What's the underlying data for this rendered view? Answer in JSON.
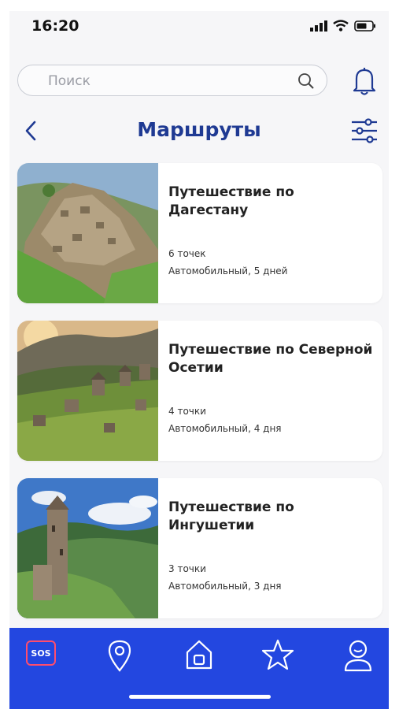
{
  "status_bar": {
    "time": "16:20",
    "icons": [
      "signal-icon",
      "wifi-icon",
      "battery-icon"
    ]
  },
  "search": {
    "placeholder": "Поиск",
    "value": ""
  },
  "header": {
    "title": "Маршруты"
  },
  "routes": [
    {
      "title": "Путешествие по Дагестану",
      "points": "6 точек",
      "meta": "Автомобильный, 5 дней"
    },
    {
      "title": "Путешествие по Северной Осетии",
      "points": "4 точки",
      "meta": "Автомобильный, 4 дня"
    },
    {
      "title": "Путешествие по Ингушетии",
      "points": "3 точки",
      "meta": "Автомобильный, 3 дня"
    }
  ],
  "tabbar": {
    "sos_label": "SOS",
    "items": [
      "sos-icon",
      "map-pin-icon",
      "home-icon",
      "star-icon",
      "profile-icon"
    ]
  },
  "colors": {
    "accent": "#1f3a93",
    "tabbar": "#2347e0",
    "sos_border": "#ff4d6d"
  }
}
